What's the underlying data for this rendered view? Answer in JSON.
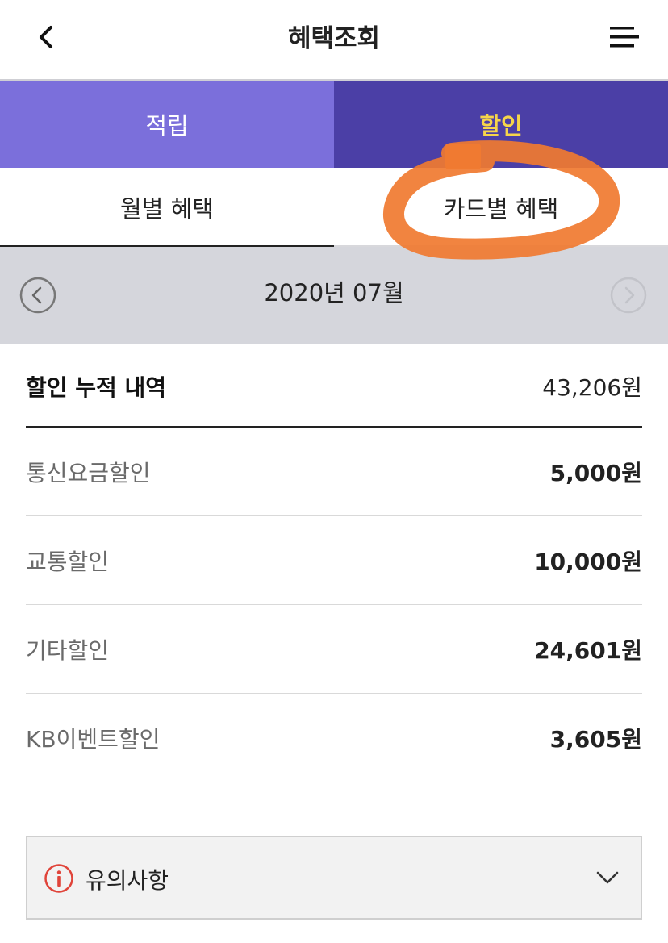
{
  "header": {
    "title": "혜택조회",
    "back_icon": "chevron-left-icon",
    "menu_icon": "hamburger-menu-icon"
  },
  "main_tabs": [
    {
      "label": "적립",
      "selected": false
    },
    {
      "label": "할인",
      "selected": true
    }
  ],
  "sub_tabs": [
    {
      "label": "월별 혜택",
      "selected": true
    },
    {
      "label": "카드별 혜택",
      "selected": false
    }
  ],
  "month_nav": {
    "label": "2020년 07월",
    "prev_icon": "circle-chevron-left-icon",
    "next_icon": "circle-chevron-right-icon",
    "next_enabled": false
  },
  "summary": {
    "total": {
      "label": "할인 누적 내역",
      "value": "43,206원"
    },
    "items": [
      {
        "label": "통신요금할인",
        "value": "5,000원"
      },
      {
        "label": "교통할인",
        "value": "10,000원"
      },
      {
        "label": "기타할인",
        "value": "24,601원"
      },
      {
        "label": "KB이벤트할인",
        "value": "3,605원"
      }
    ]
  },
  "notice": {
    "label": "유의사항",
    "icon": "info-circle-icon",
    "toggle_icon": "chevron-down-icon"
  },
  "colors": {
    "accum_tab_bg": "#7b6fdb",
    "discount_tab_bg": "#4b3fa6",
    "discount_tab_text": "#f6d54a",
    "month_bar_bg": "#d5d6dc",
    "annotation_stroke": "#f07a30",
    "notice_icon": "#e0443a"
  }
}
